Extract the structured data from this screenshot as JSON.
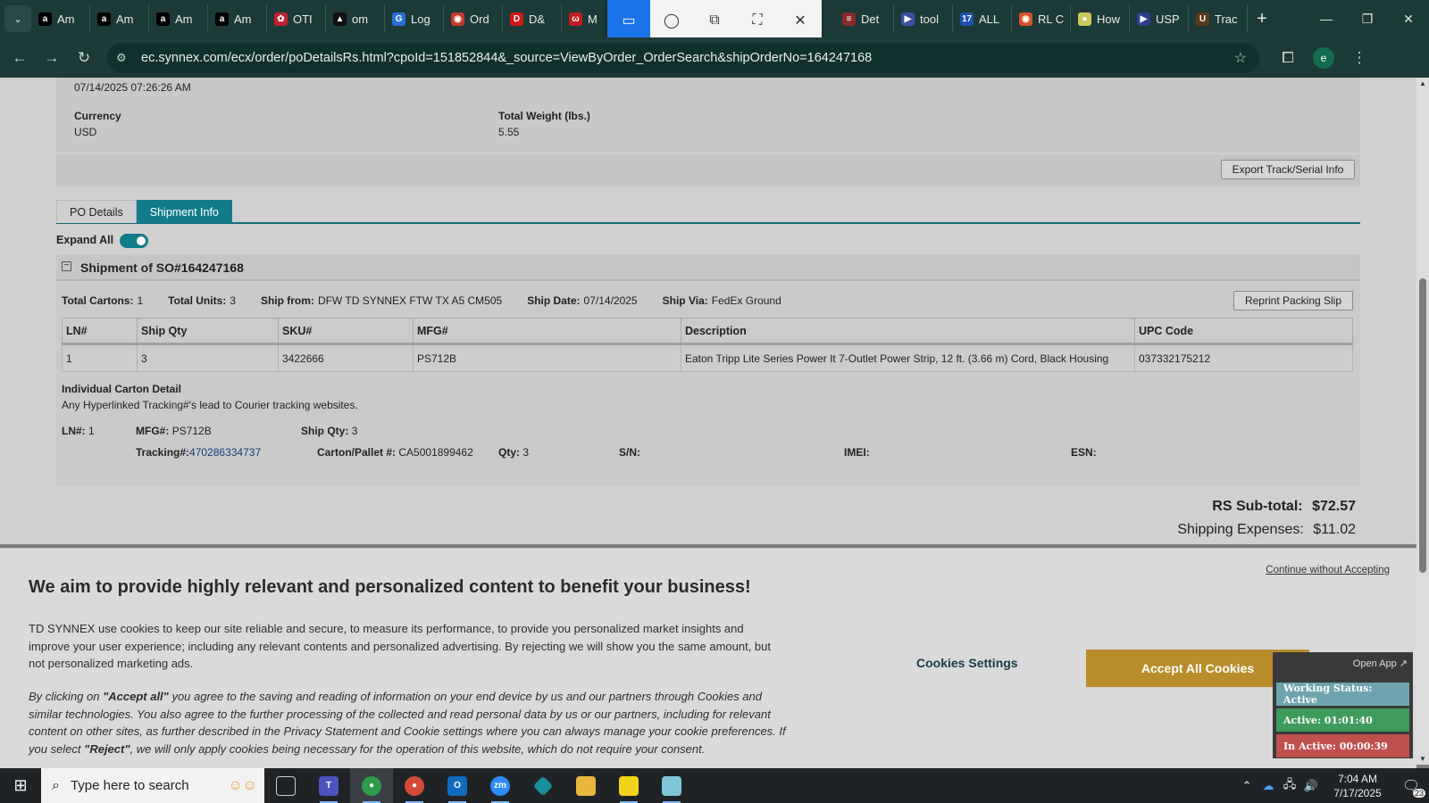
{
  "browser": {
    "tabs": [
      {
        "label": "Am",
        "icon": "amazon-icon",
        "color": "#000000",
        "glyph": "a"
      },
      {
        "label": "Am",
        "icon": "amazon-icon",
        "color": "#000000",
        "glyph": "a"
      },
      {
        "label": "Am",
        "icon": "amazon-icon",
        "color": "#000000",
        "glyph": "a"
      },
      {
        "label": "Am",
        "icon": "amazon-icon",
        "color": "#000000",
        "glyph": "a"
      },
      {
        "label": "OTI",
        "icon": "oti-icon",
        "color": "#c02030",
        "glyph": "✿"
      },
      {
        "label": "om",
        "icon": "om-icon",
        "color": "#111111",
        "glyph": "▲"
      },
      {
        "label": "Log",
        "icon": "log-icon",
        "color": "#2a6fd6",
        "glyph": "G"
      },
      {
        "label": "Ord",
        "icon": "order-icon",
        "color": "#c43a2a",
        "glyph": "◉"
      },
      {
        "label": "D&",
        "icon": "dh-icon",
        "color": "#d01818",
        "glyph": "D"
      },
      {
        "label": "M",
        "icon": "m-icon",
        "color": "#c31c1c",
        "glyph": "ω"
      }
    ],
    "tabs_right": [
      {
        "label": "Det",
        "icon": "det-icon",
        "color": "#8a2b2b",
        "glyph": "≡"
      },
      {
        "label": "tool",
        "icon": "tool-icon",
        "color": "#3a4fa0",
        "glyph": "▶"
      },
      {
        "label": "ALL",
        "icon": "seventeen-track-icon",
        "color": "#1b4fb0",
        "glyph": "17"
      },
      {
        "label": "RL C",
        "icon": "rl-icon",
        "color": "#d4512a",
        "glyph": "◉"
      },
      {
        "label": "How",
        "icon": "how-icon",
        "color": "#c9c95c",
        "glyph": "●"
      },
      {
        "label": "USP",
        "icon": "usps-icon",
        "color": "#2c3f8f",
        "glyph": "▶"
      },
      {
        "label": "Trac",
        "icon": "ups-icon",
        "color": "#5a3a1a",
        "glyph": "U"
      }
    ],
    "url": "ec.synnex.com/ecx/order/poDetailsRs.html?cpoId=151852844&_source=ViewByOrder_OrderSearch&shipOrderNo=164247168",
    "profile_initial": "e"
  },
  "order": {
    "date_value": "07/14/2025 07:26:26 AM",
    "currency_label": "Currency",
    "currency_value": "USD",
    "weight_label": "Total Weight (lbs.)",
    "weight_value": "5.55",
    "export_button": "Export Track/Serial Info",
    "tabs": [
      "PO Details",
      "Shipment Info"
    ],
    "expand_all_label": "Expand All",
    "expand_all_on": true
  },
  "shipment": {
    "title": "Shipment of SO#164247168",
    "total_cartons_label": "Total Cartons:",
    "total_cartons": "1",
    "total_units_label": "Total Units:",
    "total_units": "3",
    "ship_from_label": "Ship from:",
    "ship_from": "DFW TD SYNNEX FTW TX A5 CM505",
    "ship_date_label": "Ship Date:",
    "ship_date": "07/14/2025",
    "ship_via_label": "Ship Via:",
    "ship_via": "FedEx Ground",
    "reprint_button": "Reprint Packing Slip",
    "columns": [
      "LN#",
      "Ship Qty",
      "SKU#",
      "MFG#",
      "Description",
      "UPC Code"
    ],
    "rows": [
      [
        "1",
        "3",
        "3422666",
        "PS712B",
        "Eaton Tripp Lite Series Power It 7-Outlet Power Strip, 12 ft. (3.66 m) Cord, Black Housing",
        "037332175212"
      ]
    ],
    "carton_title": "Individual Carton Detail",
    "carton_note": "Any Hyperlinked Tracking#'s lead to Courier tracking websites.",
    "ln_label": "LN#:",
    "ln_value": "1",
    "mfg_label": "MFG#:",
    "mfg_value": "PS712B",
    "shipqty_label": "Ship Qty:",
    "shipqty_value": "3",
    "tracking_label": "Tracking#:",
    "tracking_value": "470286334737",
    "carton_label": "Carton/Pallet #:",
    "carton_value": "CA5001899462",
    "qty_label": "Qty:",
    "qty_value": "3",
    "sn_label": "S/N:",
    "imei_label": "IMEI:",
    "esn_label": "ESN:"
  },
  "totals": {
    "subtotal_label": "RS Sub-total:",
    "subtotal_value": "$72.57",
    "shipping_label": "Shipping Expenses:",
    "shipping_value": "$11.02"
  },
  "cookie": {
    "continue_link": "Continue without Accepting",
    "title": "We aim to provide highly relevant and personalized content to benefit your business!",
    "p1": "TD SYNNEX use cookies to keep our site reliable and secure, to measure its performance, to provide you personalized market insights and improve your user experience; including any relevant contents and personalized advertising. By rejecting we will show you the same amount, but not personalized marketing ads.",
    "p2_intro": "By clicking on ",
    "p2_accept": "\"Accept all\"",
    "p2_mid": "  you agree to the saving and reading of information on your end device by us and our partners through Cookies and similar technologies. You also agree to the further processing of the collected and read personal data by us or our partners, including for relevant content on other sites, as further described in the Privacy Statement and Cookie settings where you can always manage your cookie preferences. If you select ",
    "p2_reject": "\"Reject\"",
    "p2_end": ", we will only apply cookies being necessary for the operation of this website, which do not require your consent.",
    "settings_button": "Cookies Settings",
    "accept_button": "Accept All Cookies"
  },
  "time_widget": {
    "open_app": "Open App ↗",
    "status": "Working Status: Active",
    "active": "Active: 01:01:40",
    "inactive": "In Active: 00:00:39",
    "status_color": "#6fa3b0",
    "active_color": "#3f9b5c",
    "inactive_color": "#c0504d"
  },
  "taskbar": {
    "search_placeholder": "Type here to search",
    "time": "7:04 AM",
    "date": "7/17/2025",
    "notif_count": "23"
  }
}
